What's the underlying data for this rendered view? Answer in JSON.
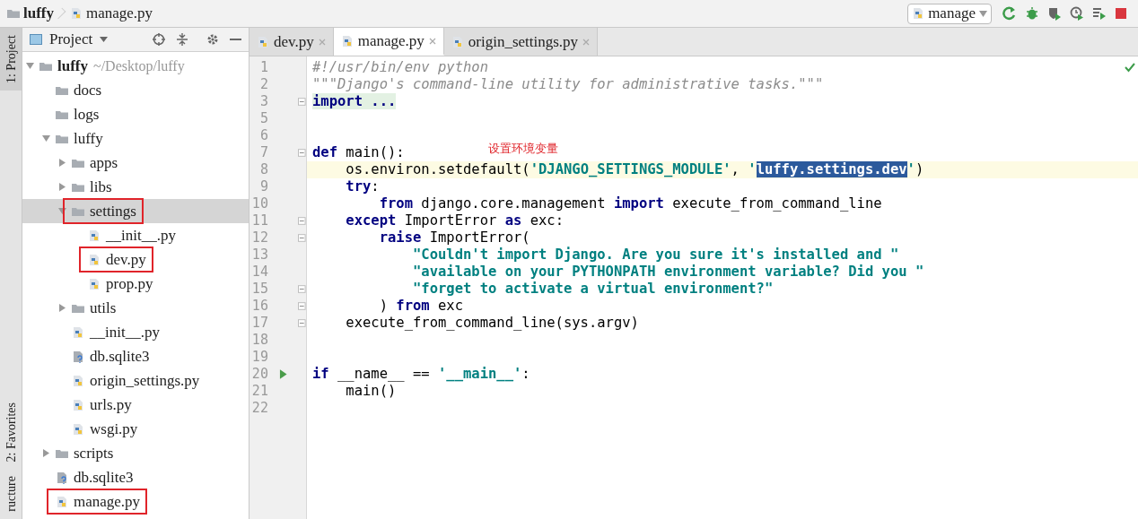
{
  "breadcrumb": [
    {
      "label": "luffy",
      "kind": "folder"
    },
    {
      "label": "manage.py",
      "kind": "python"
    }
  ],
  "run_config": {
    "label": "manage"
  },
  "side_tools": [
    {
      "label": "1: Project",
      "selected": true
    },
    {
      "label": "2: Favorites",
      "selected": false
    },
    {
      "label": "ructure",
      "selected": false
    }
  ],
  "project_panel": {
    "title": "Project"
  },
  "tree": [
    {
      "label": "luffy",
      "hint": "~/Desktop/luffy",
      "kind": "folder",
      "expanded": true,
      "selected": false,
      "marked": false,
      "children": [
        {
          "label": "docs",
          "kind": "folder",
          "selected": false,
          "marked": false
        },
        {
          "label": "logs",
          "kind": "folder",
          "selected": false,
          "marked": false
        },
        {
          "label": "luffy",
          "kind": "folder",
          "expanded": true,
          "selected": false,
          "marked": false,
          "children": [
            {
              "label": "apps",
              "kind": "folder",
              "expanded": false,
              "selected": false,
              "marked": false
            },
            {
              "label": "libs",
              "kind": "folder",
              "expanded": false,
              "selected": false,
              "marked": false
            },
            {
              "label": "settings",
              "kind": "folder",
              "expanded": true,
              "selected": true,
              "marked": true,
              "children": [
                {
                  "label": "__init__.py",
                  "kind": "python",
                  "selected": false,
                  "marked": false
                },
                {
                  "label": "dev.py",
                  "kind": "python",
                  "selected": false,
                  "marked": true
                },
                {
                  "label": "prop.py",
                  "kind": "python",
                  "selected": false,
                  "marked": false
                }
              ]
            },
            {
              "label": "utils",
              "kind": "folder",
              "expanded": false,
              "selected": false,
              "marked": false
            },
            {
              "label": "__init__.py",
              "kind": "python",
              "selected": false,
              "marked": false
            },
            {
              "label": "db.sqlite3",
              "kind": "unknown",
              "selected": false,
              "marked": false
            },
            {
              "label": "origin_settings.py",
              "kind": "python",
              "selected": false,
              "marked": false
            },
            {
              "label": "urls.py",
              "kind": "python",
              "selected": false,
              "marked": false
            },
            {
              "label": "wsgi.py",
              "kind": "python",
              "selected": false,
              "marked": false
            }
          ]
        },
        {
          "label": "scripts",
          "kind": "folder",
          "expanded": false,
          "selected": false,
          "marked": false
        },
        {
          "label": "db.sqlite3",
          "kind": "unknown",
          "selected": false,
          "marked": false
        },
        {
          "label": "manage.py",
          "kind": "python",
          "selected": false,
          "marked": true
        }
      ]
    }
  ],
  "tabs": [
    {
      "label": "dev.py",
      "selected": false
    },
    {
      "label": "manage.py",
      "selected": true
    },
    {
      "label": "origin_settings.py",
      "selected": false
    }
  ],
  "annotation": "设置环境变量",
  "lines": [
    {
      "number": "1",
      "tokens": [
        {
          "kind": "comment",
          "text": "#!/usr/bin/env python"
        }
      ]
    },
    {
      "number": "2",
      "tokens": [
        {
          "kind": "comment",
          "text": "\"\"\"Django's command-line utility for administrative tasks.\"\"\""
        }
      ]
    },
    {
      "number": "3",
      "fold": true,
      "tokens": [
        {
          "kind": "folded",
          "text": "import ..."
        }
      ]
    },
    {
      "number": "5"
    },
    {
      "number": "6"
    },
    {
      "number": "7",
      "fold": true,
      "tokens": [
        {
          "kind": "keyword",
          "text": "def"
        },
        {
          "kind": "plain",
          "text": " main():"
        }
      ]
    },
    {
      "number": "8",
      "current": true,
      "tokens": [
        {
          "kind": "plain",
          "text": "    os.environ.setdefault("
        },
        {
          "kind": "string",
          "text": "'DJANGO_SETTINGS_MODULE'"
        },
        {
          "kind": "plain",
          "text": ", "
        },
        {
          "kind": "string",
          "text": "'"
        },
        {
          "kind": "selection",
          "text": "luffy.settings.dev"
        },
        {
          "kind": "string",
          "text": "'"
        },
        {
          "kind": "plain",
          "text": ")"
        }
      ]
    },
    {
      "number": "9",
      "tokens": [
        {
          "kind": "keyword",
          "text": "    try"
        },
        {
          "kind": "plain",
          "text": ":"
        }
      ]
    },
    {
      "number": "10",
      "tokens": [
        {
          "kind": "keyword",
          "text": "        from"
        },
        {
          "kind": "plain",
          "text": " django.core.management "
        },
        {
          "kind": "keyword",
          "text": "import"
        },
        {
          "kind": "plain",
          "text": " execute_from_command_line"
        }
      ]
    },
    {
      "number": "11",
      "fold": true,
      "tokens": [
        {
          "kind": "keyword",
          "text": "    except"
        },
        {
          "kind": "plain",
          "text": " ImportError "
        },
        {
          "kind": "keyword",
          "text": "as"
        },
        {
          "kind": "plain",
          "text": " exc:"
        }
      ]
    },
    {
      "number": "12",
      "fold": true,
      "tokens": [
        {
          "kind": "keyword",
          "text": "        raise"
        },
        {
          "kind": "plain",
          "text": " ImportError("
        }
      ]
    },
    {
      "number": "13",
      "tokens": [
        {
          "kind": "string",
          "text": "            \"Couldn't import Django. Are you sure it's installed and \""
        }
      ]
    },
    {
      "number": "14",
      "tokens": [
        {
          "kind": "string",
          "text": "            \"available on your PYTHONPATH environment variable? Did you \""
        }
      ]
    },
    {
      "number": "15",
      "fold": true,
      "tokens": [
        {
          "kind": "string",
          "text": "            \"forget to activate a virtual environment?\""
        }
      ]
    },
    {
      "number": "16",
      "fold": true,
      "tokens": [
        {
          "kind": "plain",
          "text": "        ) "
        },
        {
          "kind": "keyword",
          "text": "from"
        },
        {
          "kind": "plain",
          "text": " exc"
        }
      ]
    },
    {
      "number": "17",
      "fold": true,
      "tokens": [
        {
          "kind": "plain",
          "text": "    execute_from_command_line(sys.argv)"
        }
      ]
    },
    {
      "number": "18"
    },
    {
      "number": "19"
    },
    {
      "number": "20",
      "run": true,
      "tokens": [
        {
          "kind": "keyword",
          "text": "if"
        },
        {
          "kind": "plain",
          "text": " __name__ == "
        },
        {
          "kind": "string",
          "text": "'__main__'"
        },
        {
          "kind": "plain",
          "text": ":"
        }
      ]
    },
    {
      "number": "21",
      "tokens": [
        {
          "kind": "plain",
          "text": "    main()"
        }
      ]
    },
    {
      "number": "22"
    }
  ]
}
